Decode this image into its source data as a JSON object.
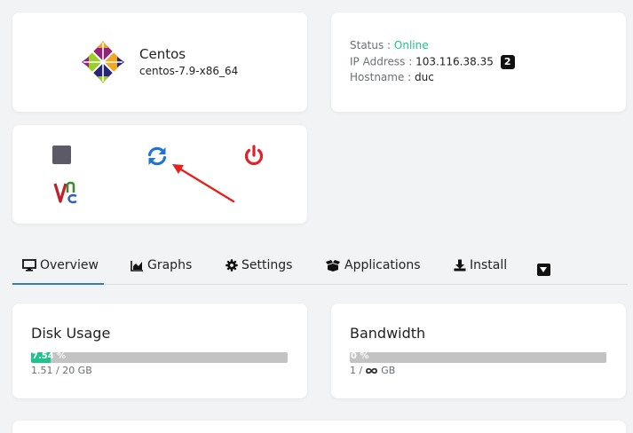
{
  "os": {
    "name": "Centos",
    "version": "centos-7.9-x86_64",
    "logo_icon": "centos-logo-icon"
  },
  "info": {
    "status_label": "Status : ",
    "status_value": "Online",
    "ip_label": "IP Address : ",
    "ip_value": "103.116.38.35",
    "ip_badge": "2",
    "hostname_label": "Hostname : ",
    "hostname_value": "duc"
  },
  "power": {
    "stop_icon": "stop-icon",
    "restart_icon": "restart-icon",
    "poweroff_icon": "power-icon",
    "vnc_icon": "vnc-icon"
  },
  "tabs": [
    {
      "label": "Overview",
      "icon": "monitor-icon",
      "active": true
    },
    {
      "label": "Graphs",
      "icon": "area-chart-icon"
    },
    {
      "label": "Settings",
      "icon": "gear-icon"
    },
    {
      "label": "Applications",
      "icon": "boxes-icon"
    },
    {
      "label": "Install",
      "icon": "download-icon"
    }
  ],
  "disk": {
    "title": "Disk Usage",
    "percent_label": "7.54 %",
    "percent": 7.54,
    "usage_text": "1.51 / 20 GB"
  },
  "bandwidth": {
    "title": "Bandwidth",
    "percent_label": "0 %",
    "percent": 0,
    "usage_prefix": "1 / ",
    "usage_unit": "GB",
    "infinity_icon": "infinity-icon"
  },
  "colors": {
    "accent": "#2f7fc4",
    "online": "#1ec28b",
    "power_red": "#e0222a",
    "restart_blue": "#1f74d6"
  }
}
